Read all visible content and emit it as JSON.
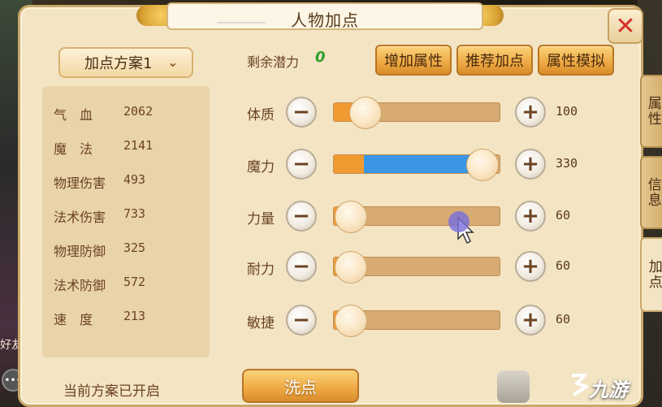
{
  "title": "人物加点",
  "scheme": {
    "selected": "加点方案1"
  },
  "stats": [
    {
      "label": "气　血",
      "value": "2062"
    },
    {
      "label": "魔　法",
      "value": "2141"
    },
    {
      "label": "物理伤害",
      "value": "493"
    },
    {
      "label": "法术伤害",
      "value": "733"
    },
    {
      "label": "物理防御",
      "value": "325"
    },
    {
      "label": "法术防御",
      "value": "572"
    },
    {
      "label": "速　度",
      "value": "213"
    }
  ],
  "status": "当前方案已开启",
  "potential": {
    "label": "剩余潜力",
    "value": "0"
  },
  "buttons": {
    "add_attr": "增加属性",
    "recommend": "推荐加点",
    "simulate": "属性模拟",
    "wash": "洗点"
  },
  "attributes": [
    {
      "label": "体质",
      "value": "100",
      "base_fraction": 0.16,
      "added_fraction": 0.0,
      "knob_fraction": 0.19
    },
    {
      "label": "魔力",
      "value": "330",
      "base_fraction": 0.18,
      "added_fraction": 0.64,
      "knob_fraction": 0.89
    },
    {
      "label": "力量",
      "value": "60",
      "base_fraction": 0.1,
      "added_fraction": 0.0,
      "knob_fraction": 0.1
    },
    {
      "label": "耐力",
      "value": "60",
      "base_fraction": 0.1,
      "added_fraction": 0.0,
      "knob_fraction": 0.1
    },
    {
      "label": "敏捷",
      "value": "60",
      "base_fraction": 0.1,
      "added_fraction": 0.0,
      "knob_fraction": 0.1
    }
  ],
  "side_tabs": [
    {
      "label": "属性",
      "active": false
    },
    {
      "label": "信息",
      "active": false
    },
    {
      "label": "加点",
      "active": true
    }
  ],
  "left_hud": {
    "friend_label": "好友"
  },
  "watermark": "九游",
  "icons": {
    "close": "close-icon",
    "dropdown": "chevron-down-icon",
    "minus": "minus-icon",
    "plus": "plus-icon",
    "chat": "chat-icon"
  },
  "colors": {
    "orange_fill": "#f29a32",
    "blue_fill": "#3b97e6",
    "potential_green": "#2f9e2a",
    "close_red": "#d5302a"
  }
}
